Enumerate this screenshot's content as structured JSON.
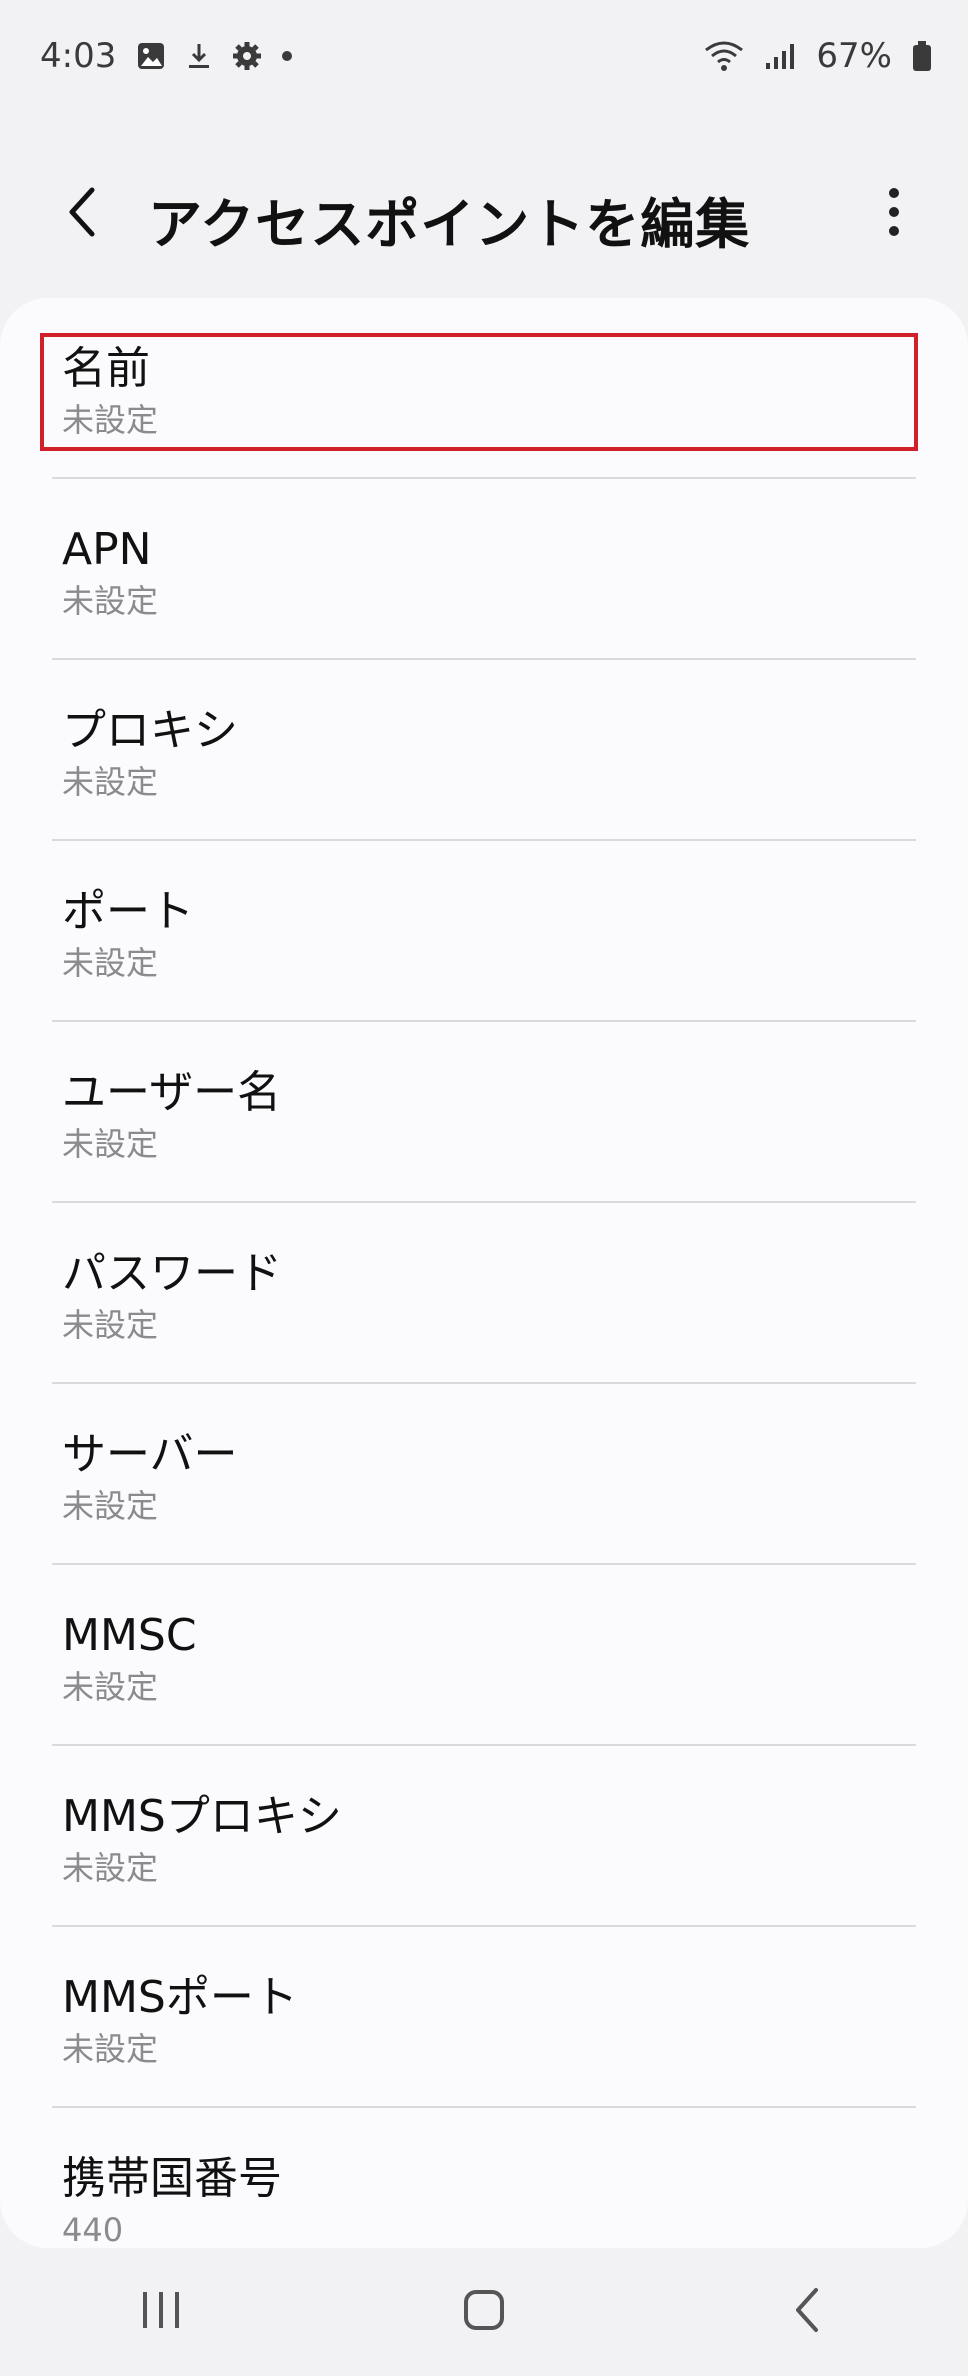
{
  "status_bar": {
    "time": "4:03",
    "battery": "67%",
    "icons_left": [
      "gallery-icon",
      "download-icon",
      "settings-gear-icon",
      "notification-dot-icon"
    ],
    "icons_right": [
      "wifi-icon",
      "signal-icon",
      "battery-icon"
    ]
  },
  "app_bar": {
    "title": "アクセスポイントを編集",
    "back_icon": "chevron-left-icon",
    "more_icon": "more-vertical-icon"
  },
  "list": {
    "items": [
      {
        "title": "名前",
        "value": "未設定"
      },
      {
        "title": "APN",
        "value": "未設定"
      },
      {
        "title": "プロキシ",
        "value": "未設定"
      },
      {
        "title": "ポート",
        "value": "未設定"
      },
      {
        "title": "ユーザー名",
        "value": "未設定"
      },
      {
        "title": "パスワード",
        "value": "未設定"
      },
      {
        "title": "サーバー",
        "value": "未設定"
      },
      {
        "title": "MMSC",
        "value": "未設定"
      },
      {
        "title": "MMSプロキシ",
        "value": "未設定"
      },
      {
        "title": "MMSポート",
        "value": "未設定"
      },
      {
        "title": "携帯国番号",
        "value": "440"
      }
    ]
  },
  "highlight": {
    "color": "#d0202a"
  },
  "nav_bar": {
    "icons": [
      "recent-apps-icon",
      "home-icon",
      "back-icon"
    ]
  }
}
